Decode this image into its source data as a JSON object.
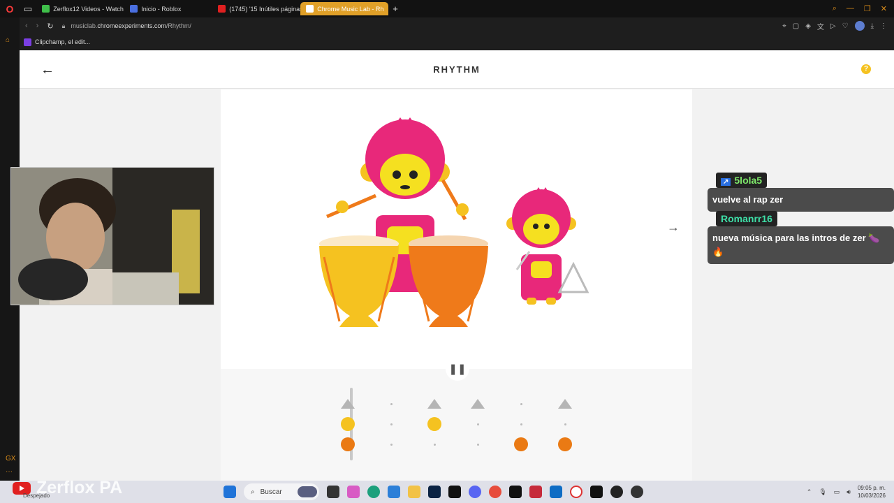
{
  "browser": {
    "tabs": [
      {
        "label": "Zerflox12 Videos - Watch",
        "color": "#3fbf4a"
      },
      {
        "label": "Inicio - Roblox",
        "color": "#4a6fe0"
      },
      {
        "label": "(1745) '15 Inútiles páginas",
        "color": "#e02020"
      },
      {
        "label": "Chrome Music Lab - Rh",
        "color": "#ffffff"
      }
    ],
    "url_prefix": "musiclab.",
    "url_domain": "chromeexperiments.com",
    "url_path": "/Rhythm/",
    "bookmark": "Clipchamp, el edit..."
  },
  "app": {
    "title": "RHYTHM",
    "help_label": "?"
  },
  "sequencer": {
    "columns": [
      {
        "triangle": true,
        "yellow": true,
        "orange": true
      },
      {
        "triangle": false,
        "yellow": false,
        "orange": false
      },
      {
        "triangle": true,
        "yellow": true,
        "orange": false
      },
      {
        "triangle": true,
        "yellow": false,
        "orange": false
      },
      {
        "triangle": false,
        "yellow": false,
        "orange": true
      },
      {
        "triangle": true,
        "yellow": false,
        "orange": true
      }
    ],
    "colors": {
      "yellow": "#f5c220",
      "orange": "#ea7a14",
      "triangle": "#b5b5b5"
    }
  },
  "chat": [
    {
      "user": "5lola5",
      "user_color": "#7ee86a",
      "message": "vuelve al rap zer"
    },
    {
      "user": "Romanrr16",
      "user_color": "#3ee0a8",
      "message": "nueva música para las intros de zer 🍆🔥"
    }
  ],
  "stream": {
    "channel": "Zerflox PA",
    "weather": "Despejado"
  },
  "taskbar": {
    "search_placeholder": "Buscar",
    "time": "09:05 p. m.",
    "date": "10/03/2026"
  }
}
